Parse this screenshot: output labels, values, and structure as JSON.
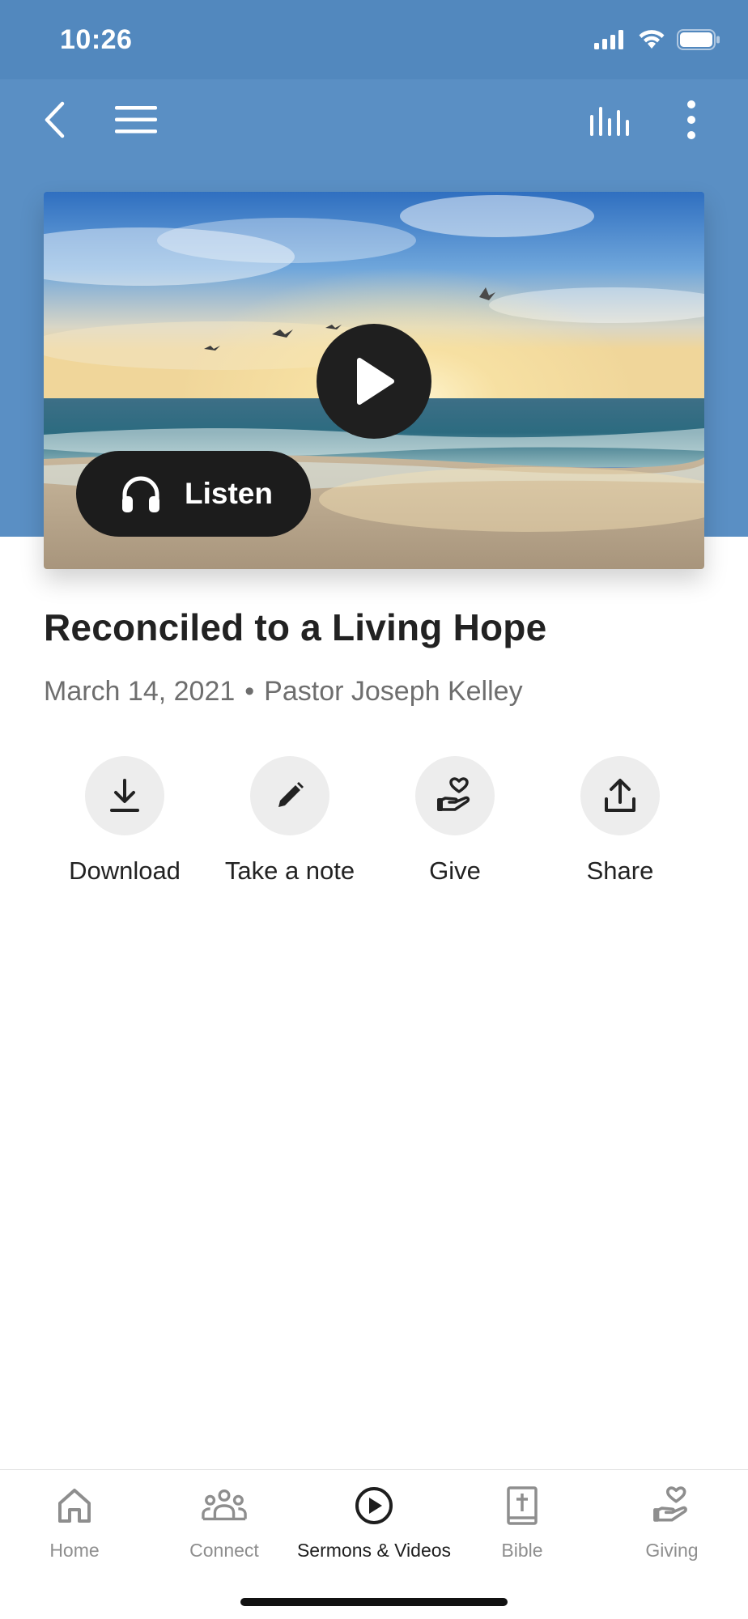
{
  "status_bar": {
    "time": "10:26"
  },
  "colors": {
    "header_blue": "#5a8fc4",
    "status_blue": "#5288be",
    "button_dark": "#1c1c1c",
    "action_bg": "#ededed",
    "muted_text": "#6e6e6e"
  },
  "nav": {
    "left_icons": [
      "back-chevron-icon",
      "hamburger-menu-icon"
    ],
    "right_icons": [
      "audio-bars-icon",
      "more-vertical-icon"
    ]
  },
  "media": {
    "play_icon": "play-icon",
    "listen_icon": "headphones-icon",
    "listen_label": "Listen"
  },
  "sermon": {
    "title": "Reconciled to a Living Hope",
    "date": "March 14, 2021",
    "separator": "•",
    "speaker": "Pastor Joseph Kelley"
  },
  "actions": [
    {
      "icon": "download-icon",
      "label": "Download"
    },
    {
      "icon": "pencil-icon",
      "label": "Take a note"
    },
    {
      "icon": "heart-hand-icon",
      "label": "Give"
    },
    {
      "icon": "share-upload-icon",
      "label": "Share"
    }
  ],
  "tabs": [
    {
      "icon": "home-icon",
      "label": "Home",
      "active": false
    },
    {
      "icon": "people-icon",
      "label": "Connect",
      "active": false
    },
    {
      "icon": "play-circle-icon",
      "label": "Sermons & Videos",
      "active": true
    },
    {
      "icon": "bible-icon",
      "label": "Bible",
      "active": false
    },
    {
      "icon": "heart-hand-icon",
      "label": "Giving",
      "active": false
    }
  ]
}
